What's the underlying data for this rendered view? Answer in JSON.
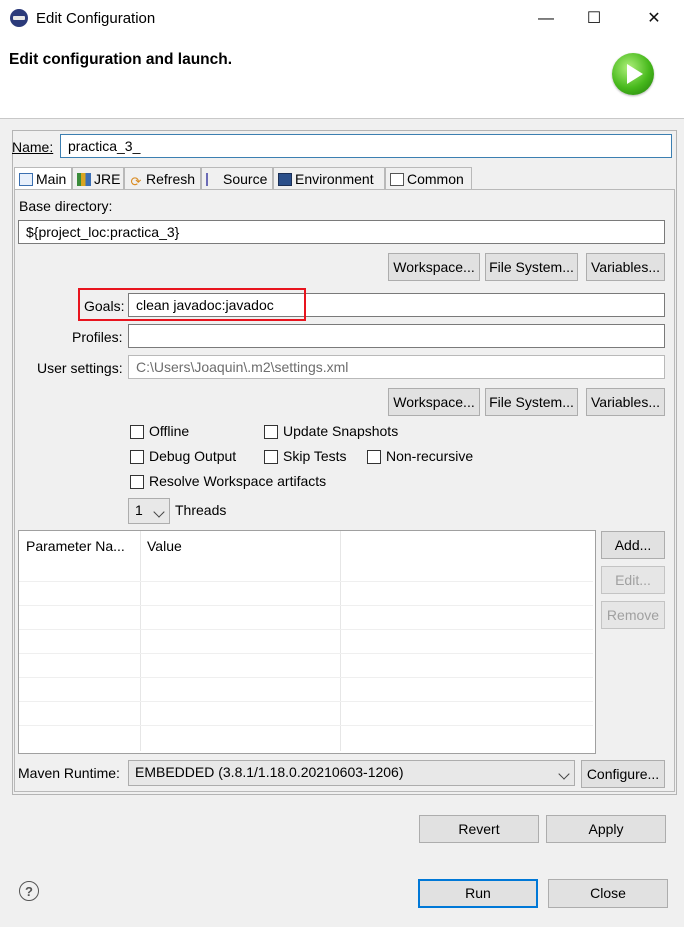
{
  "window": {
    "title": "Edit Configuration",
    "minimize_glyph": "—",
    "maximize_glyph": "☐",
    "close_glyph": "✕"
  },
  "header": {
    "title": "Edit configuration and launch."
  },
  "name_field": {
    "label": "Name:",
    "value": "practica_3_"
  },
  "tabs": [
    {
      "label": "Main",
      "icon": "main-tab-icon"
    },
    {
      "label": "JRE",
      "icon": "jre-tab-icon"
    },
    {
      "label": "Refresh",
      "icon": "refresh-tab-icon"
    },
    {
      "label": "Source",
      "icon": "source-tab-icon"
    },
    {
      "label": "Environment",
      "icon": "environment-tab-icon"
    },
    {
      "label": "Common",
      "icon": "common-tab-icon"
    }
  ],
  "main": {
    "base_dir_label": "Base directory:",
    "base_dir_value": "${project_loc:practica_3}",
    "workspace_btn": "Workspace...",
    "filesystem_btn": "File System...",
    "variables_btn": "Variables...",
    "goals_label": "Goals:",
    "goals_value": "clean javadoc:javadoc",
    "profiles_label": "Profiles:",
    "profiles_value": "",
    "user_settings_label": "User settings:",
    "user_settings_value": "C:\\Users\\Joaquin\\.m2\\settings.xml",
    "checkboxes": {
      "offline": "Offline",
      "update_snapshots": "Update Snapshots",
      "debug_output": "Debug Output",
      "skip_tests": "Skip Tests",
      "non_recursive": "Non-recursive",
      "resolve_workspace": "Resolve Workspace artifacts"
    },
    "threads_value": "1",
    "threads_label": "Threads",
    "params_table": {
      "columns": [
        "Parameter Na...",
        "Value"
      ],
      "rows": []
    },
    "add_btn": "Add...",
    "edit_btn": "Edit...",
    "remove_btn": "Remove",
    "runtime_label": "Maven Runtime:",
    "runtime_value": "EMBEDDED (3.8.1/1.18.0.20210603-1206)",
    "configure_btn": "Configure..."
  },
  "footer": {
    "revert_btn": "Revert",
    "apply_btn": "Apply",
    "run_btn": "Run",
    "close_btn": "Close",
    "help_glyph": "?"
  },
  "colors": {
    "highlight": "#e8141e",
    "focus_border": "#3c7fb1",
    "default_button_border": "#0078d7"
  }
}
